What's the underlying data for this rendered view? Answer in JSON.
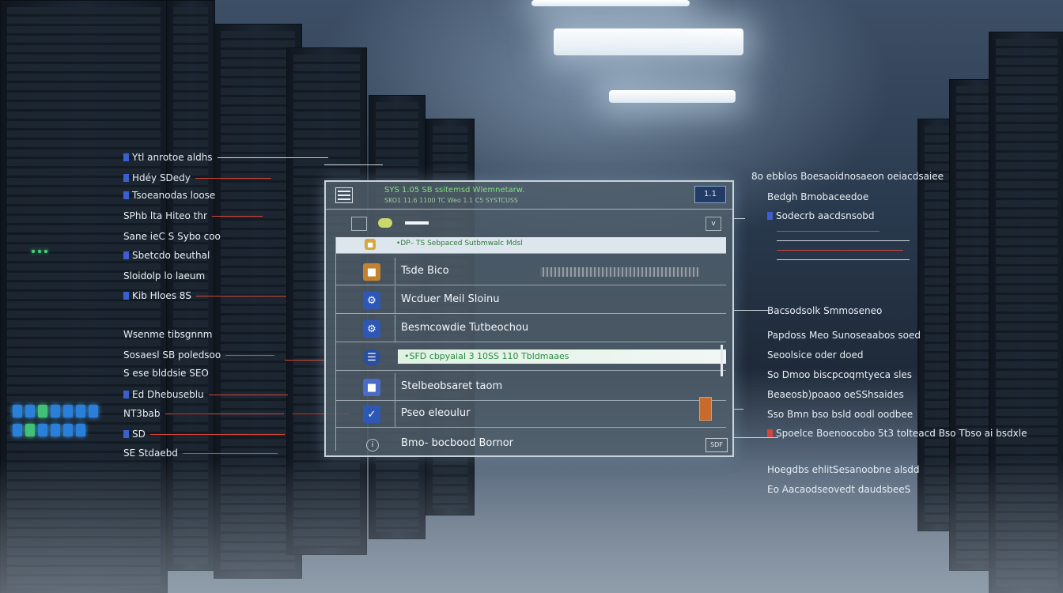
{
  "panel": {
    "header_title": "SYS 1.05 SB ssitemsd Wlemnetarw.",
    "header_subtitle": "SKO1 11.6 1100 TC Weo 1.1 C5 SYSTCUSS",
    "header_button": "1.1",
    "toolbar_chevron": "v",
    "rows": [
      {
        "label": "•DP– TS Sebpaced Sutbmwalc Mdsl",
        "icon": "folder-icon"
      },
      {
        "label": "Tsde Bico",
        "icon": "folder-icon"
      },
      {
        "label": "Wcduer Meil Sloinu",
        "icon": "gear-icon"
      },
      {
        "label": "Besmcowdie Tutbeochou",
        "icon": "gear-icon"
      },
      {
        "label": "•SFD cbpyaiaI 3 10SS 110  Tbldmaaes",
        "icon": "database-icon",
        "highlight": true
      },
      {
        "label": "Stelbeobsaret taom",
        "icon": "folder-icon"
      },
      {
        "label": "Pseo eleoulur",
        "icon": "shield-icon"
      },
      {
        "label": "Bmo- bocbood Bornor",
        "icon": "info-icon"
      }
    ],
    "corner_label": "SDF"
  },
  "left_labels": [
    "Ytl  anrotoe aldhs",
    "Hdéy SDedy",
    "Tsoeanodas loose",
    "SPhb lta  Hiteo thr",
    "Sane ieC S Sybo coo",
    "Sbetcdo beuthal",
    "Sloidolp  lo laeum",
    "Kib  Hloes 8S",
    "Wsenme tibsgnnm",
    "Sosaesl SB poledsoo",
    "S ese blddsie SEO",
    "Ed  Dhebuseblu",
    "NT3bab",
    "SD",
    "SE Stdaebd"
  ],
  "right_labels": [
    "8o ebblos Boesaoidnosaeon oeiacdsaiee",
    "Bedgh Bmobaceedoe",
    "Sodecrb aacdsnsobd",
    "Bacsodsolk  Smmoseneo",
    "Papdoss Meo Sunoseaabos soed",
    "Seoolsice oder  doed",
    "So Dmoo biscpcoqmtyeca sles",
    "Beaeosb)poaoo oeSShsaides",
    "Sso Bmn bso bsld oodl  oodbee",
    "Spoelce Boenoocobo 5t3 tolteacd Bso  Tbso ai bsdxle",
    "Hoegdbs ehlitSesanoobne alsdd",
    "Eo  Aacaodseovedt  daudsbeeS"
  ],
  "colors": {
    "accent_green": "#7fe07f",
    "accent_red": "#d3463a",
    "accent_blue": "#3c5fd0",
    "highlight_text": "#2a8a40"
  }
}
